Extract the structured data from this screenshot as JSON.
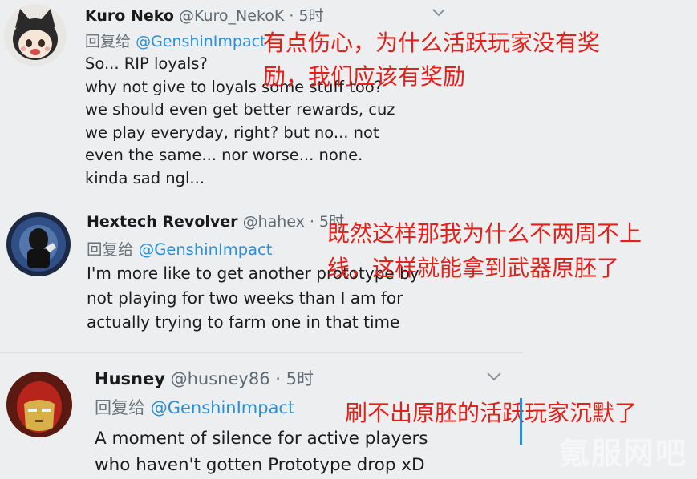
{
  "tweets": [
    {
      "name": "Kuro Neko",
      "handle": "@Kuro_NekoK",
      "dot": "·",
      "time": "5时",
      "reply_prefix": "回复给",
      "reply_mention": "@GenshinImpact",
      "lines": [
        "So... RIP loyals?",
        "why not give to loyals some stuff too?",
        "we should even get better rewards, cuz",
        "we play everyday, right? but no...  not",
        "even the same... nor worse... none.",
        "kinda sad ngl..."
      ],
      "annotation": [
        "有点伤心，为什么活跃玩家没有奖",
        "励，我们应该有奖励"
      ]
    },
    {
      "name": "Hextech Revolver",
      "handle": "@hahex",
      "dot": "·",
      "time": "5时",
      "reply_prefix": "回复给",
      "reply_mention": "@GenshinImpact",
      "lines": [
        "I'm more like to get another prototype by",
        "not playing for two weeks than I am for",
        "actually trying to farm one in that time"
      ],
      "annotation": [
        "既然这样那我为什么不两周不上",
        "线，这样就能拿到武器原胚了"
      ]
    },
    {
      "name": "Husney",
      "handle": "@husney86",
      "dot": "·",
      "time": "5时",
      "reply_prefix": "回复给",
      "reply_mention": "@GenshinImpact",
      "lines": [
        "A moment of silence for active players",
        "who haven't gotten Prototype drop xD"
      ],
      "annotation": [
        "刷不出原胚的活跃玩家沉默了"
      ]
    }
  ],
  "watermark": "氪服网吧",
  "icons": {
    "menu": "chevron-down-icon"
  },
  "colors": {
    "mention": "#2b8fd8",
    "annotation": "#e32019",
    "background": "#eceeef"
  }
}
